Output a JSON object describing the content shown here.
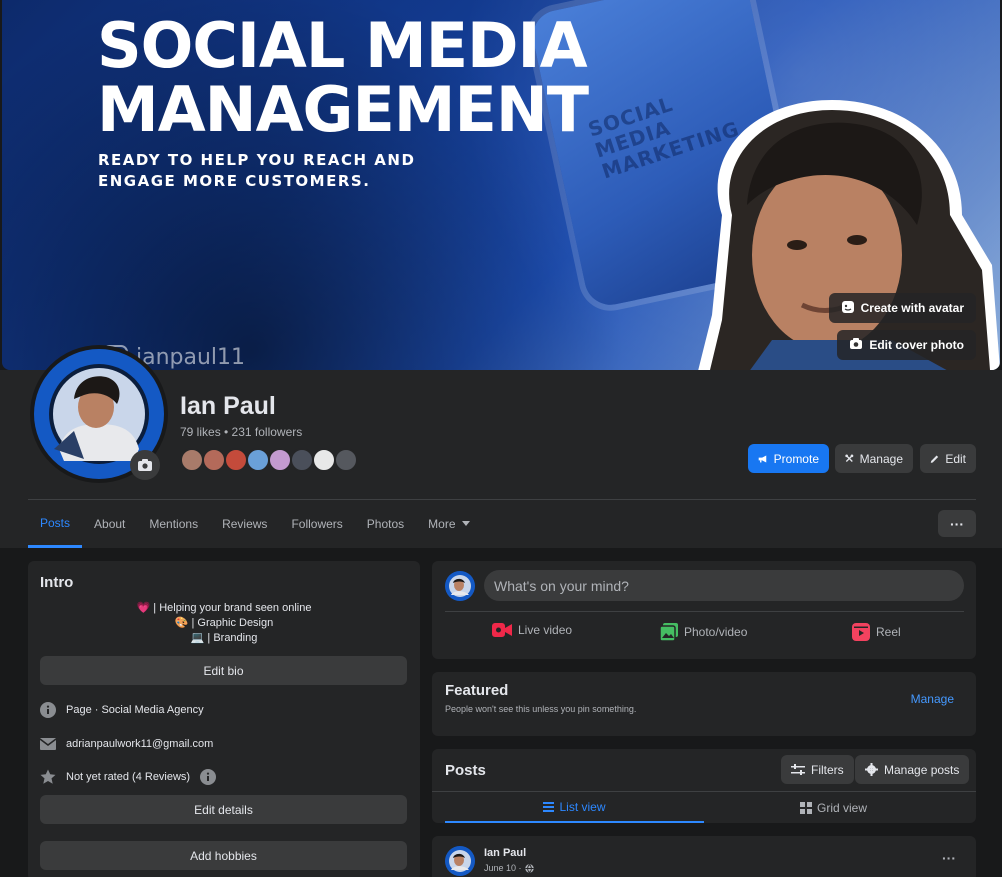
{
  "cover": {
    "title_line1": "SOCIAL MEDIA",
    "title_line2": "MANAGEMENT",
    "subtitle": "READY TO HELP YOU REACH AND ENGAGE MORE CUSTOMERS.",
    "phone_text": "SOCIAL MEDIA MARKETING",
    "handle": "ianpaul11",
    "create_avatar_label": "Create with avatar",
    "edit_cover_label": "Edit cover photo"
  },
  "profile": {
    "name": "Ian Paul",
    "stats": "79 likes • 231 followers",
    "follower_avatar_colors": [
      "#a87b6a",
      "#b46a5a",
      "#c44b3b",
      "#6aa0d8",
      "#c39ad0",
      "#4a4f5a",
      "#e8e8e8",
      "#55585e"
    ]
  },
  "actions": {
    "promote": "Promote",
    "manage": "Manage",
    "edit": "Edit"
  },
  "tabs": [
    {
      "label": "Posts"
    },
    {
      "label": "About"
    },
    {
      "label": "Mentions"
    },
    {
      "label": "Reviews"
    },
    {
      "label": "Followers"
    },
    {
      "label": "Photos"
    },
    {
      "label": "More"
    }
  ],
  "more_dots": "···",
  "intro": {
    "title": "Intro",
    "bio": [
      {
        "emoji": "💗",
        "text": " | Helping your brand seen online"
      },
      {
        "emoji": "🎨",
        "text": " | Graphic Design"
      },
      {
        "emoji": "💻",
        "text": " | Branding"
      }
    ],
    "edit_bio": "Edit bio",
    "category": "Page · Social Media Agency",
    "email": "adrianpaulwork11@gmail.com",
    "rating": "Not yet rated (4 Reviews)",
    "edit_details": "Edit details",
    "add_hobbies": "Add hobbies"
  },
  "composer": {
    "placeholder": "What's on your mind?",
    "live_video": "Live video",
    "photo_video": "Photo/video",
    "reel": "Reel"
  },
  "featured": {
    "title": "Featured",
    "subtitle": "People won't see this unless you pin something.",
    "manage": "Manage"
  },
  "posts": {
    "title": "Posts",
    "filters": "Filters",
    "manage_posts": "Manage posts",
    "list_view": "List view",
    "grid_view": "Grid view"
  },
  "post": {
    "author": "Ian Paul",
    "date": "June 10 ·",
    "more": "···"
  },
  "colors": {
    "accent": "#1877f2",
    "link": "#2d88ff",
    "background": "#18191a",
    "card": "#242526"
  }
}
